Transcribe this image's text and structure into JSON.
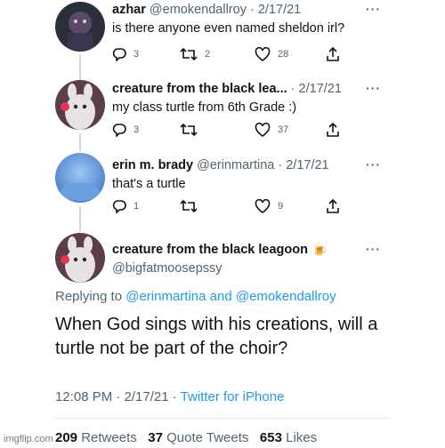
{
  "tweets": [
    {
      "name": "azhar",
      "handle": "@emokendallroy",
      "date": "· 2/17/21",
      "text": "is there anyone even named sheldon irl?",
      "replies": "3",
      "retweets": "2",
      "likes": "28",
      "avatar_color": "#2b2f3a"
    },
    {
      "name": "creature from the black lea...",
      "handle": "",
      "date": "· 2/17/21",
      "text": "my class turtle from 6th Grade :)",
      "replies": "3",
      "retweets": "",
      "likes": "37",
      "avatar_color": "#c9c3c8"
    },
    {
      "name": "erin m. brady",
      "handle": "@erinmartina",
      "date": "· 2/17/21",
      "text": "that's a turtle",
      "replies": "1",
      "retweets": "",
      "likes": "9",
      "avatar_color": "#5b8fd6"
    }
  ],
  "main_tweet": {
    "name": "creature from the black leagoon",
    "emoji": "🍺",
    "handle": "@bigfatmoosepssy",
    "replying_prefix": "Replying to",
    "replying_user_1": "@erinmartina",
    "replying_and": "and",
    "replying_user_2": "@emokendallroy",
    "text": "When God sings with his creations, will a turtle not be part of the choir?",
    "time": "12:08 PM · 2/17/21 ·",
    "source": "Twitter for iPhone",
    "retweets_count": "209",
    "retweets_label": "Retweets",
    "quotes_count": "37",
    "quotes_label": "Quote Tweets",
    "likes_count": "653",
    "likes_label": "Likes",
    "avatar_color": "#c9c3c8"
  },
  "more_label": "···",
  "watermark": "imgflip.com",
  "colors": {
    "link": "#1d9bf0",
    "secondary": "#536471",
    "text": "#0f1419",
    "connector": "#cfd9de"
  }
}
